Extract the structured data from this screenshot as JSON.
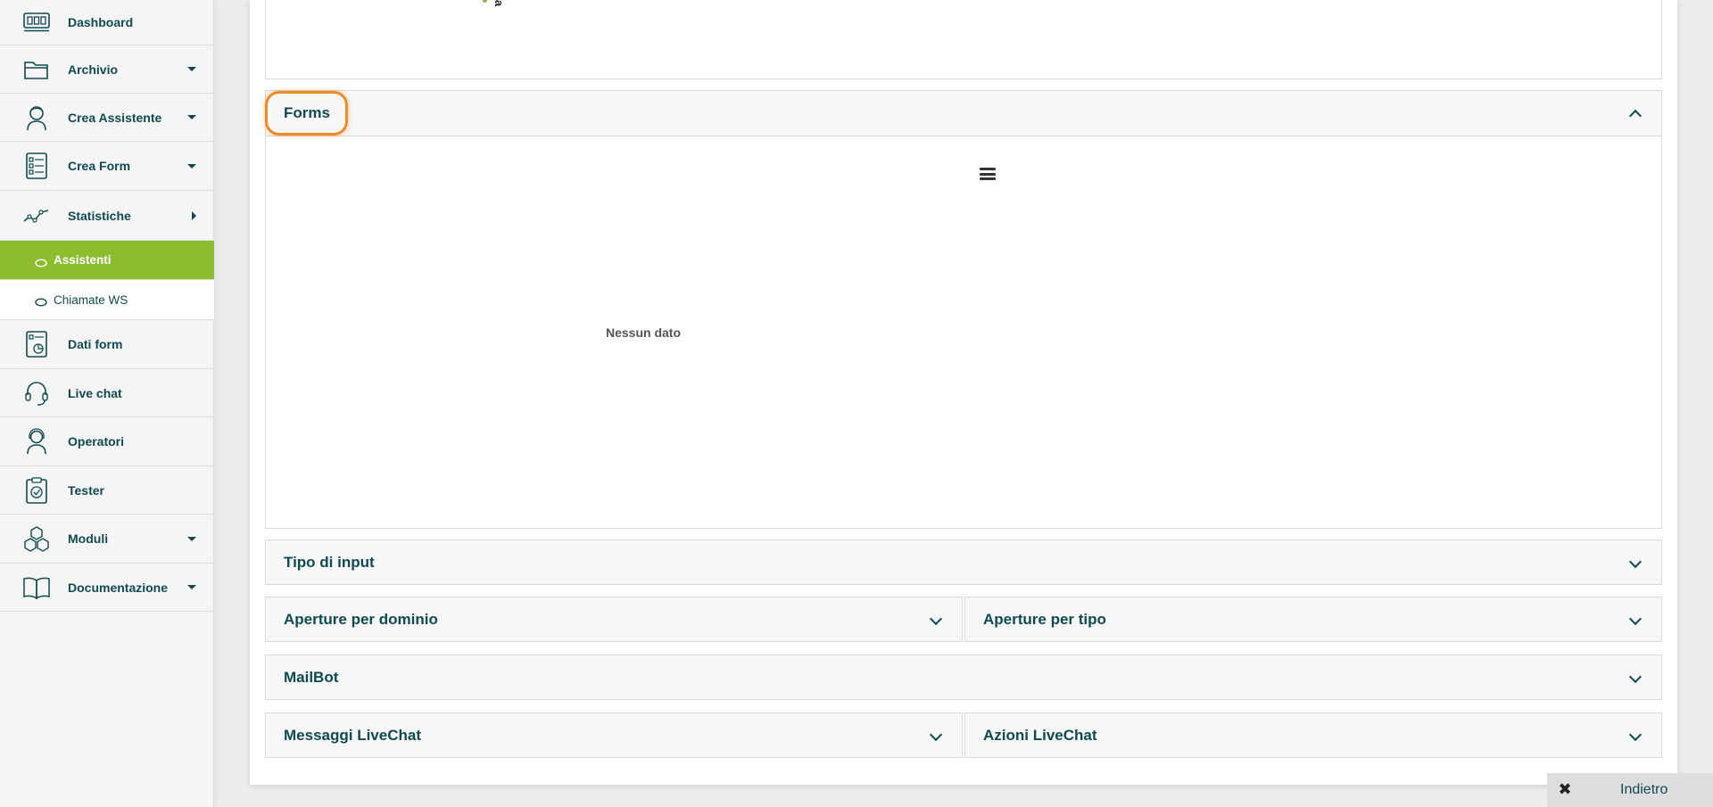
{
  "sidebar": {
    "items": [
      {
        "label": "Dashboard",
        "icon": "dashboard-icon"
      },
      {
        "label": "Archivio",
        "icon": "folder-icon"
      },
      {
        "label": "Crea Assistente",
        "icon": "assistant-icon"
      },
      {
        "label": "Crea Form",
        "icon": "form-icon"
      },
      {
        "label": "Statistiche",
        "icon": "chart-icon"
      },
      {
        "label": "Dati form",
        "icon": "form-data-icon"
      },
      {
        "label": "Live chat",
        "icon": "headset-icon"
      },
      {
        "label": "Operatori",
        "icon": "operator-icon"
      },
      {
        "label": "Tester",
        "icon": "clipboard-check-icon"
      },
      {
        "label": "Moduli",
        "icon": "cubes-icon"
      },
      {
        "label": "Documentazione",
        "icon": "book-icon"
      }
    ],
    "sub_items": [
      {
        "label": "Assistenti",
        "active": true
      },
      {
        "label": "Chiamate WS",
        "active": false
      }
    ]
  },
  "top_panel": {
    "fragment_text": "a"
  },
  "panels": {
    "forms": {
      "title": "Forms",
      "empty_text": "Nessun dato"
    },
    "tipo_input": {
      "title": "Tipo di input"
    },
    "aperture_dominio": {
      "title": "Aperture per dominio"
    },
    "aperture_tipo": {
      "title": "Aperture per tipo"
    },
    "mailbot": {
      "title": "MailBot"
    },
    "messaggi_livechat": {
      "title": "Messaggi LiveChat"
    },
    "azioni_livechat": {
      "title": "Azioni LiveChat"
    }
  },
  "footer": {
    "back_label": "Indietro",
    "close_symbol": "✖"
  },
  "colors": {
    "accent": "#8cbd2f",
    "text": "#0f4a52",
    "highlight": "#f08a24"
  }
}
